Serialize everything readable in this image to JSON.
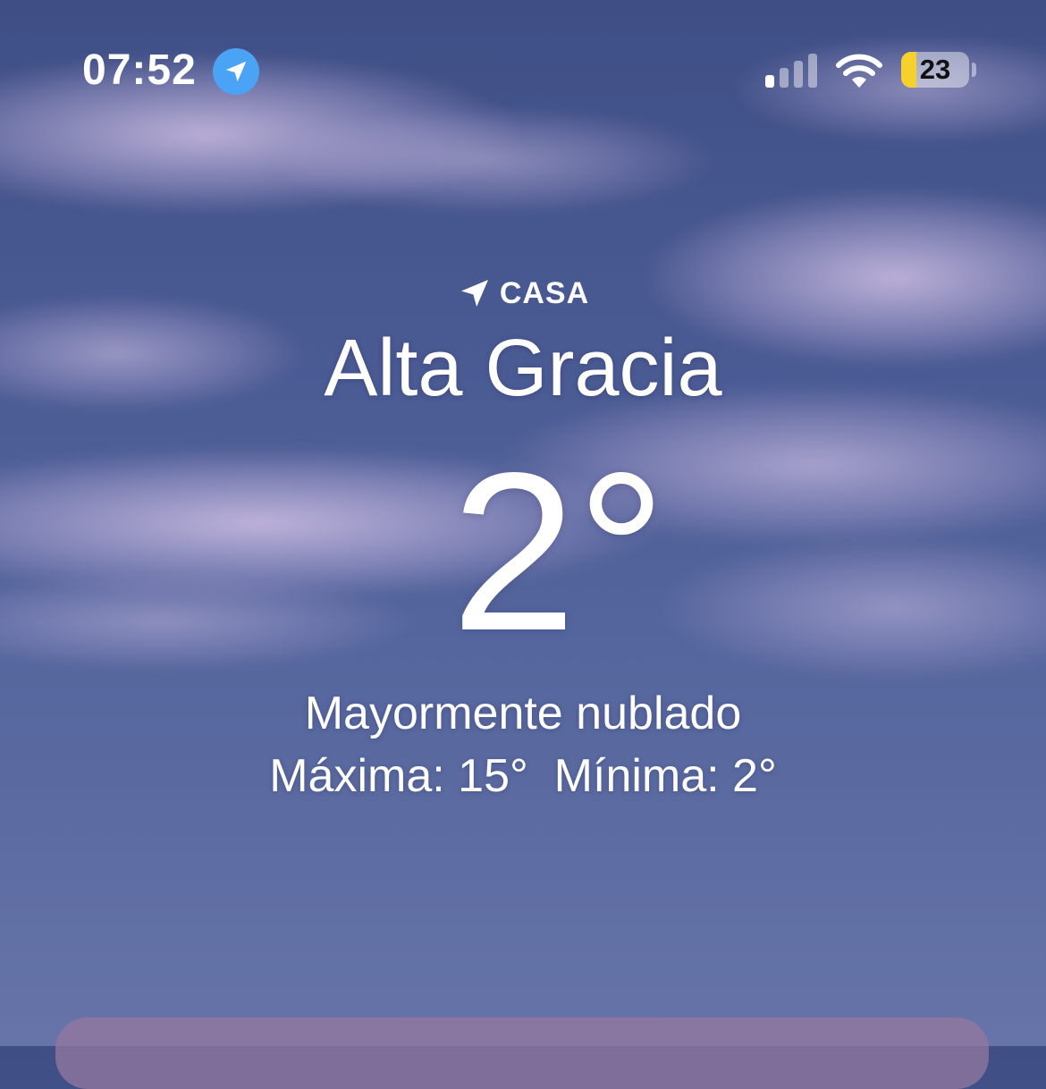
{
  "status_bar": {
    "time": "07:52",
    "battery_level": "23",
    "battery_fraction": 0.23,
    "battery_color": "#f7d12b",
    "location_badge_color": "#4aa3f5",
    "icons": [
      "location-arrow-icon",
      "cellular-signal-icon",
      "wifi-icon",
      "battery-icon"
    ]
  },
  "weather": {
    "location_label": "CASA",
    "city": "Alta Gracia",
    "temperature": "2°",
    "condition": "Mayormente nublado",
    "high_low": "Máxima: 15°  Mínima: 2°"
  }
}
